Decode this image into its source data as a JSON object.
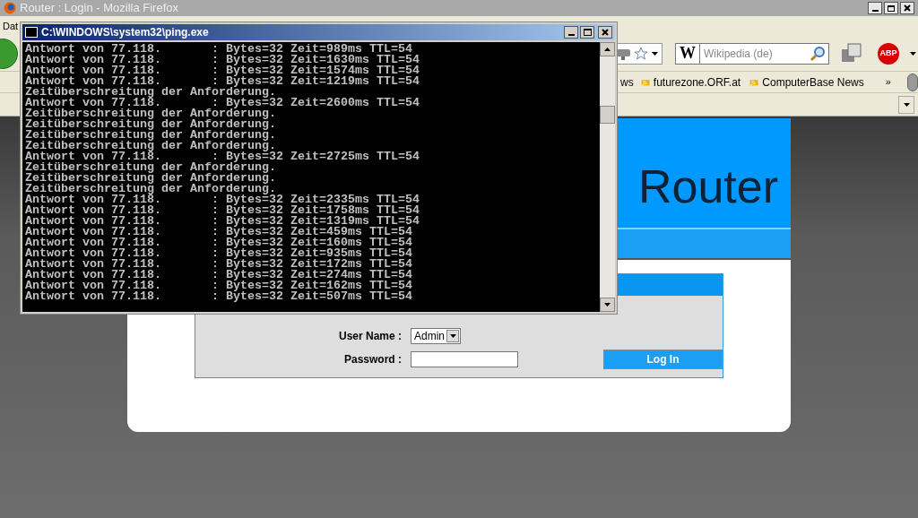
{
  "browser": {
    "title": "Router : Login - Mozilla Firefox",
    "menu": [
      "Dat"
    ],
    "search": {
      "placeholder": "Wikipedia (de)",
      "engine": "W"
    },
    "adblock": "ABP",
    "bookmarks": [
      "ws",
      "futurezone.ORF.at",
      "ComputerBase News"
    ],
    "bookmarks_overflow": "»"
  },
  "page": {
    "heading": "Router",
    "login": {
      "user_label": "User Name :",
      "user_value": "Admin",
      "password_label": "Password :",
      "button": "Log In"
    }
  },
  "console": {
    "title": "C:\\WINDOWS\\system32\\ping.exe",
    "lines": [
      "Antwort von 77.118.       : Bytes=32 Zeit=989ms TTL=54",
      "Antwort von 77.118.       : Bytes=32 Zeit=1630ms TTL=54",
      "Antwort von 77.118.       : Bytes=32 Zeit=1574ms TTL=54",
      "Antwort von 77.118.       : Bytes=32 Zeit=1219ms TTL=54",
      "Zeitüberschreitung der Anforderung.",
      "Antwort von 77.118.       : Bytes=32 Zeit=2600ms TTL=54",
      "Zeitüberschreitung der Anforderung.",
      "Zeitüberschreitung der Anforderung.",
      "Zeitüberschreitung der Anforderung.",
      "Zeitüberschreitung der Anforderung.",
      "Antwort von 77.118.       : Bytes=32 Zeit=2725ms TTL=54",
      "Zeitüberschreitung der Anforderung.",
      "Zeitüberschreitung der Anforderung.",
      "Zeitüberschreitung der Anforderung.",
      "Antwort von 77.118.       : Bytes=32 Zeit=2335ms TTL=54",
      "Antwort von 77.118.       : Bytes=32 Zeit=1758ms TTL=54",
      "Antwort von 77.118.       : Bytes=32 Zeit=1319ms TTL=54",
      "Antwort von 77.118.       : Bytes=32 Zeit=459ms TTL=54",
      "Antwort von 77.118.       : Bytes=32 Zeit=160ms TTL=54",
      "Antwort von 77.118.       : Bytes=32 Zeit=935ms TTL=54",
      "Antwort von 77.118.       : Bytes=32 Zeit=172ms TTL=54",
      "Antwort von 77.118.       : Bytes=32 Zeit=274ms TTL=54",
      "Antwort von 77.118.       : Bytes=32 Zeit=162ms TTL=54",
      "Antwort von 77.118.       : Bytes=32 Zeit=507ms TTL=54"
    ]
  }
}
